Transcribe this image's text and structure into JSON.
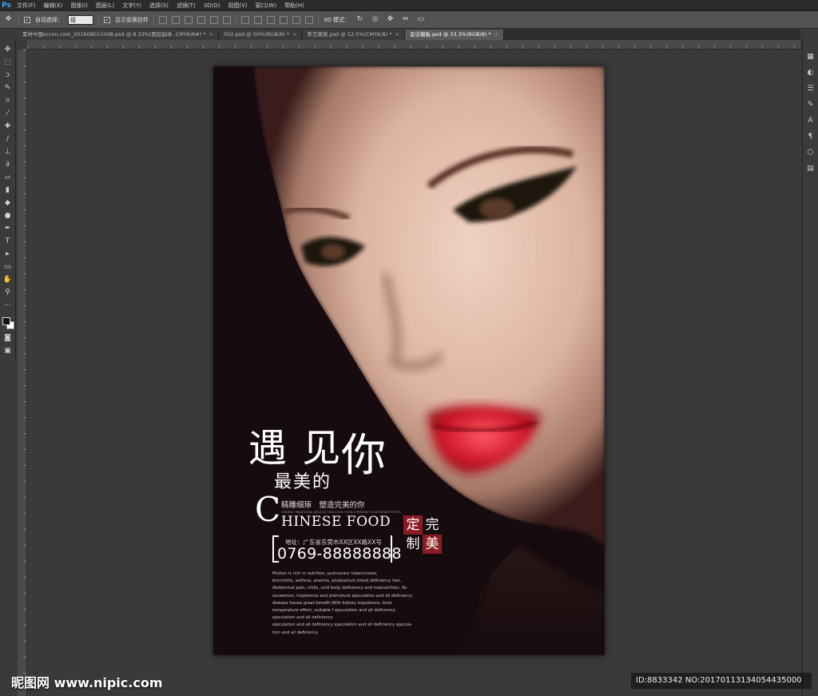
{
  "app": {
    "logo": "Ps"
  },
  "menubar": {
    "items": [
      "文件(F)",
      "编辑(E)",
      "图像(I)",
      "图层(L)",
      "文字(Y)",
      "选择(S)",
      "滤镜(T)",
      "3D(D)",
      "视图(V)",
      "窗口(W)",
      "帮助(H)"
    ]
  },
  "options": {
    "auto_select_label": "自动选择：",
    "auto_select_value": "组",
    "show_transform_label": "显示变换控件",
    "mode_3d_label": "3D 模式："
  },
  "tabs": [
    {
      "label": "素材中国sccnn.com_20160801104B.psd @ 8.33%(图层副本, CMYK/8#) *",
      "active": false
    },
    {
      "label": "002.psd @ 50%(RGB/8) *",
      "active": false
    },
    {
      "label": "茶艺展架.psd @ 12.5%(CMYK/8) *",
      "active": false
    },
    {
      "label": "会议模板.psd @ 33.3%(RGB/8) *",
      "active": true
    }
  ],
  "poster": {
    "headline_big": "遇 见",
    "headline_ni": "你",
    "headline_sub": "最美的",
    "tagline": "精雕细琢　塑造完美的你",
    "tiny_english": "CHINESE TRADITIONAL DELICACY DELICIOUS FOOD A PERSON TO ENTERTAIN PROTECTED",
    "brand_initial": "C",
    "brand_rest": "HINESE FOOD",
    "seal": [
      "定",
      "完",
      "制",
      "美"
    ],
    "address_label": "地址：广东省东莞市XX区XX路XX号",
    "phone": "0769-88888888",
    "body_lines": [
      "Mutton is rich in nutrition, pulmonary tuberculosis,",
      "bronchitis, asthma, anemia, postpartum blood deficiency two,",
      "Abdominal pain, chills, cold body deficiency and malnutrition, Ya-",
      "oxsaemun, impotence and premature ejaculation and all deficiency",
      "disease havea great benefit.With kidney impotence, tonic",
      "temperature effect, suitable f ejaculation and all deficiency",
      " ejaculation and all deficiency",
      " ejaculation and all deficiency  ejaculation and all deficiency ejacula-",
      "tion and all deficiency"
    ]
  },
  "watermark": {
    "site": "昵图网 www.nipic.com",
    "id": "ID:8833342 NO:20170113134054435000"
  },
  "colors": {
    "accent_red": "#8c1c24",
    "poster_bg": "#160b0e",
    "workspace": "#3a3a3a"
  }
}
